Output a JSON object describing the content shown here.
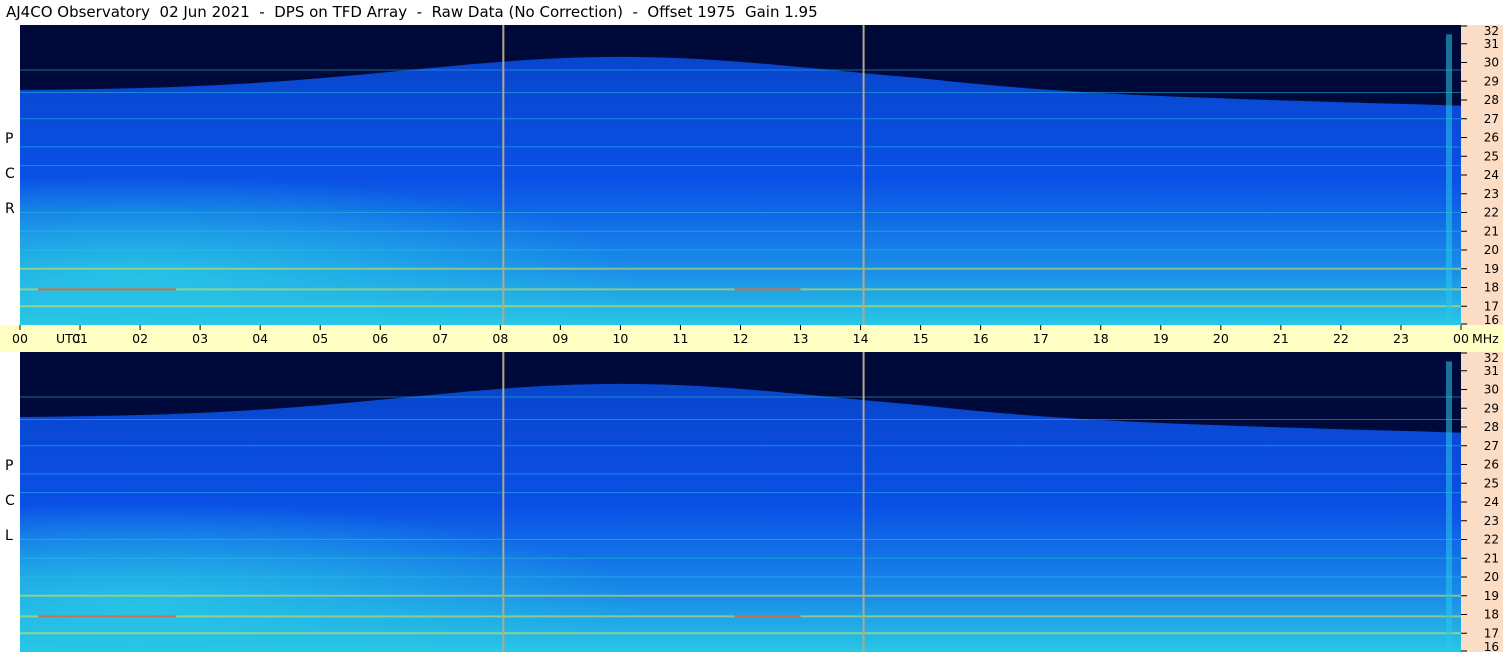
{
  "title": "AJ4CO Observatory  02 Jun 2021  -  DPS on TFD Array  -  Raw Data (No Correction)  -  Offset 1975  Gain 1.95",
  "panels": [
    {
      "id": "rcp",
      "label_letters": [
        "P",
        "C",
        "R"
      ]
    },
    {
      "id": "lcp",
      "label_letters": [
        "P",
        "C",
        "L"
      ]
    }
  ],
  "time_axis": {
    "labels": [
      "00",
      "01",
      "02",
      "03",
      "04",
      "05",
      "06",
      "07",
      "08",
      "09",
      "10",
      "11",
      "12",
      "13",
      "14",
      "15",
      "16",
      "17",
      "18",
      "19",
      "20",
      "21",
      "22",
      "23",
      "00"
    ],
    "utc_label": "UTC",
    "unit_label": "MHz"
  },
  "colors": {
    "background": "#000a3a",
    "band_blue": "#0a50e6",
    "band_cyan": "#28c8e6",
    "rfi_yellow": "#e6e640",
    "rfi_red": "#e04830",
    "time_marker": "#b4a888",
    "freq_column": "#fbdcc4",
    "time_bar": "#ffffc4"
  },
  "chart_data": {
    "type": "heatmap",
    "title": "AJ4CO Observatory  02 Jun 2021  -  DPS on TFD Array  -  Raw Data (No Correction)  -  Offset 1975  Gain 1.95",
    "x_axis": {
      "unit": "UTC",
      "range": [
        0,
        24
      ],
      "tick_labels": [
        "00",
        "01",
        "02",
        "03",
        "04",
        "05",
        "06",
        "07",
        "08",
        "09",
        "10",
        "11",
        "12",
        "13",
        "14",
        "15",
        "16",
        "17",
        "18",
        "19",
        "20",
        "21",
        "22",
        "23",
        "00"
      ]
    },
    "y_axis": {
      "unit": "MHz",
      "range": [
        16,
        32
      ],
      "tick_labels": [
        "16",
        "17",
        "18",
        "19",
        "20",
        "21",
        "22",
        "23",
        "24",
        "25",
        "26",
        "27",
        "28",
        "29",
        "30",
        "31",
        "32"
      ]
    },
    "series": [
      {
        "name": "RCP",
        "panel": "top"
      },
      {
        "name": "LCP",
        "panel": "bottom"
      }
    ],
    "time_markers_utc": [
      8.05,
      14.05
    ],
    "rfi_lines_mhz": [
      17.0,
      17.9,
      19.0,
      20.0,
      21.0,
      22.0,
      24.5,
      25.5,
      27.0,
      28.4,
      29.6
    ],
    "colormap": [
      "#000a3a",
      "#0a50e6",
      "#28c8e6",
      "#e6e640",
      "#e04830"
    ]
  }
}
